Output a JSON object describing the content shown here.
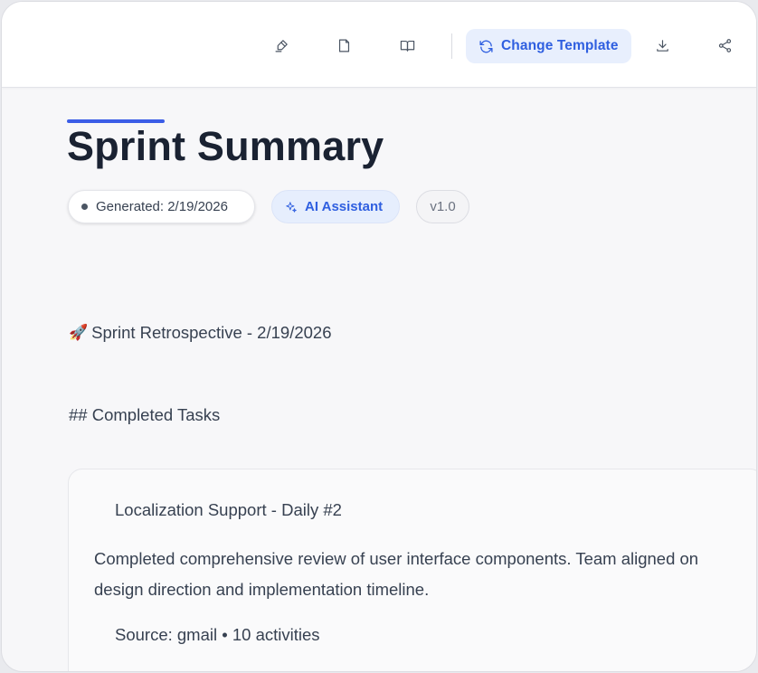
{
  "toolbar": {
    "icons": [
      "highlighter-icon",
      "note-icon",
      "book-open-icon",
      "download-icon",
      "share-icon"
    ],
    "change_template_label": "Change Template",
    "accent_color": "#2f5fe0"
  },
  "document": {
    "title": "Sprint Summary",
    "badges": {
      "generated": "Generated: 2/19/2026",
      "assistant": "AI Assistant",
      "version": "v1.0"
    },
    "retro_line": "Sprint Retrospective - 2/19/2026",
    "section_heading": "## Completed Tasks",
    "tasks": [
      {
        "title": "Localization Support - Daily #2",
        "description": "Completed comprehensive review of user interface components. Team aligned on design direction and implementation timeline.",
        "source": "Source: gmail • 10 activities"
      }
    ]
  }
}
